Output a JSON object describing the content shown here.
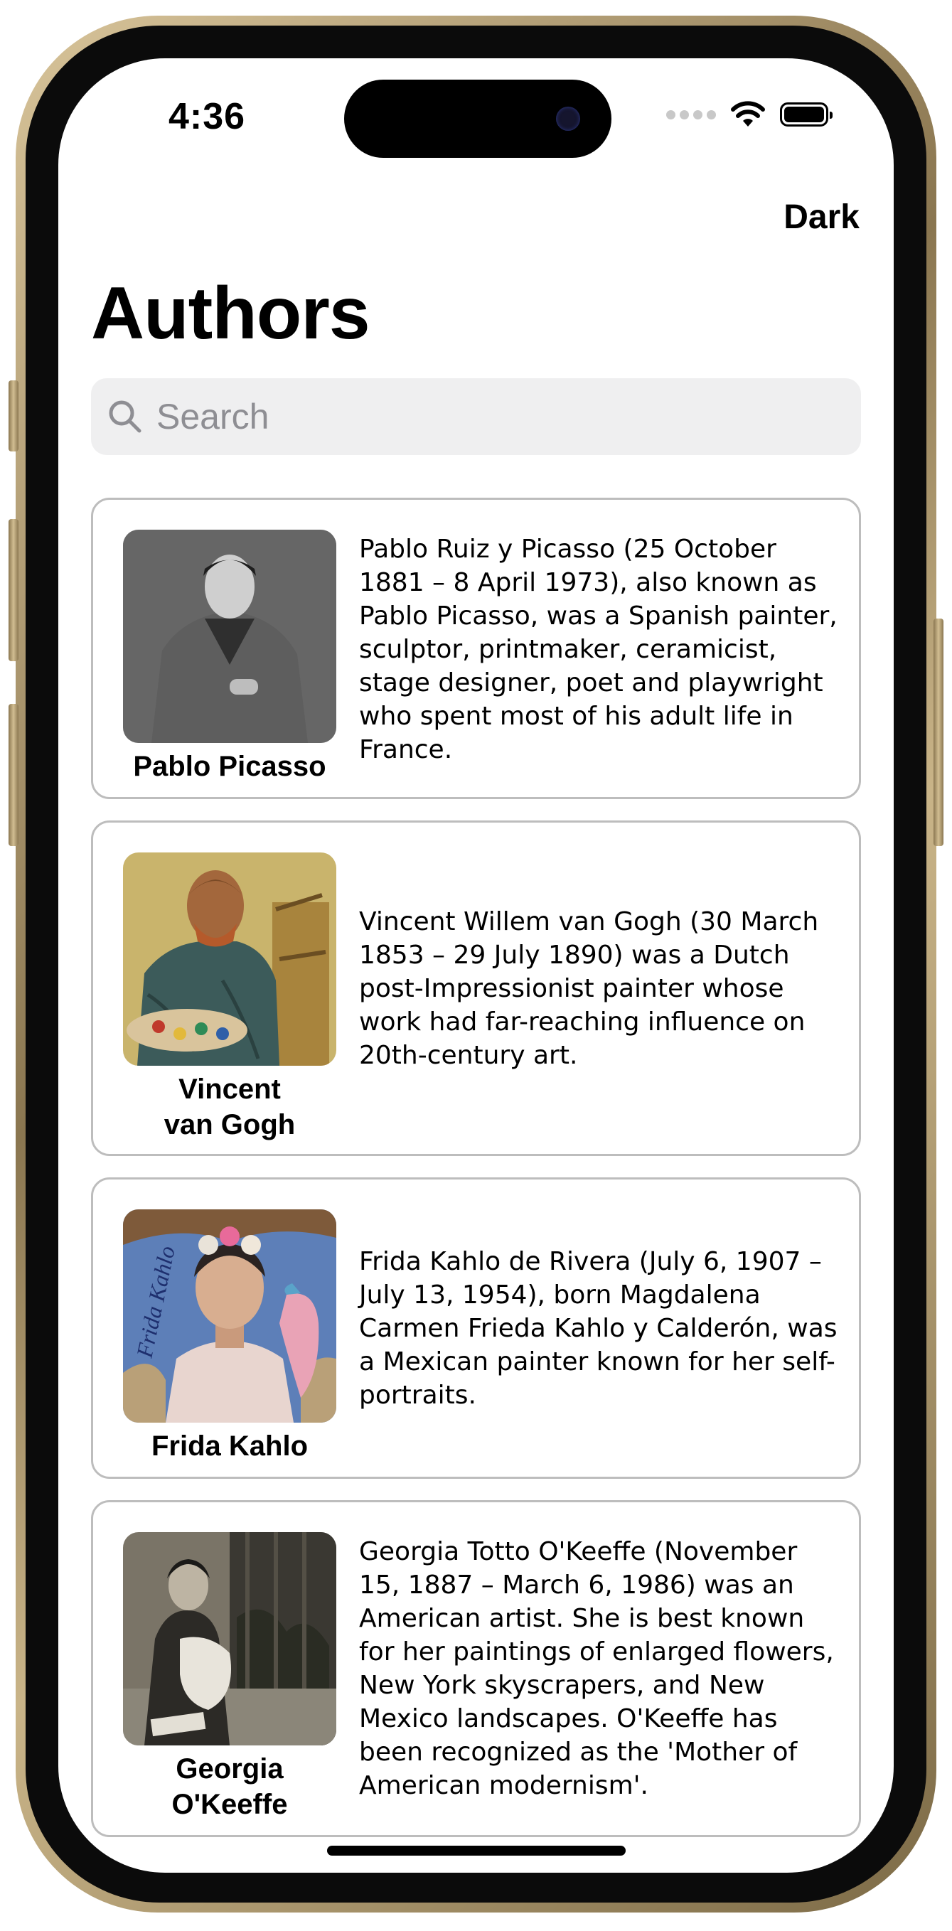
{
  "status": {
    "time": "4:36"
  },
  "nav": {
    "toggle_label": "Dark"
  },
  "page": {
    "title": "Authors"
  },
  "search": {
    "placeholder": "Search",
    "value": ""
  },
  "authors": [
    {
      "name": "Pablo Picasso",
      "bio": "Pablo Ruiz y Picasso (25 October 1881 – 8 April 1973), also known as Pablo Picasso, was a Spanish painter, sculptor, printmaker, ceramicist, stage designer, poet and playwright who spent most of his adult life in France."
    },
    {
      "name": "Vincent van Gogh",
      "bio": "Vincent Willem van Gogh (30 March 1853 – 29 July 1890) was a Dutch post-Impressionist painter whose work had far-reaching influence on 20th-century art."
    },
    {
      "name": "Frida Kahlo",
      "bio": "Frida Kahlo de Rivera (July 6, 1907 – July 13, 1954), born Magdalena Carmen Frieda Kahlo y Calderón, was a Mexican painter known for her self-portraits."
    },
    {
      "name": "Georgia O'Keeffe",
      "bio": "Georgia Totto O'Keeffe (November 15, 1887 – March 6, 1986) was an American artist. She is best known for her paintings of enlarged flowers, New York skyscrapers, and New Mexico landscapes. O'Keeffe has been recognized as the 'Mother of American modernism'."
    }
  ],
  "portrait_texts": {
    "kahlo_signature": "Frida Kahlo"
  }
}
